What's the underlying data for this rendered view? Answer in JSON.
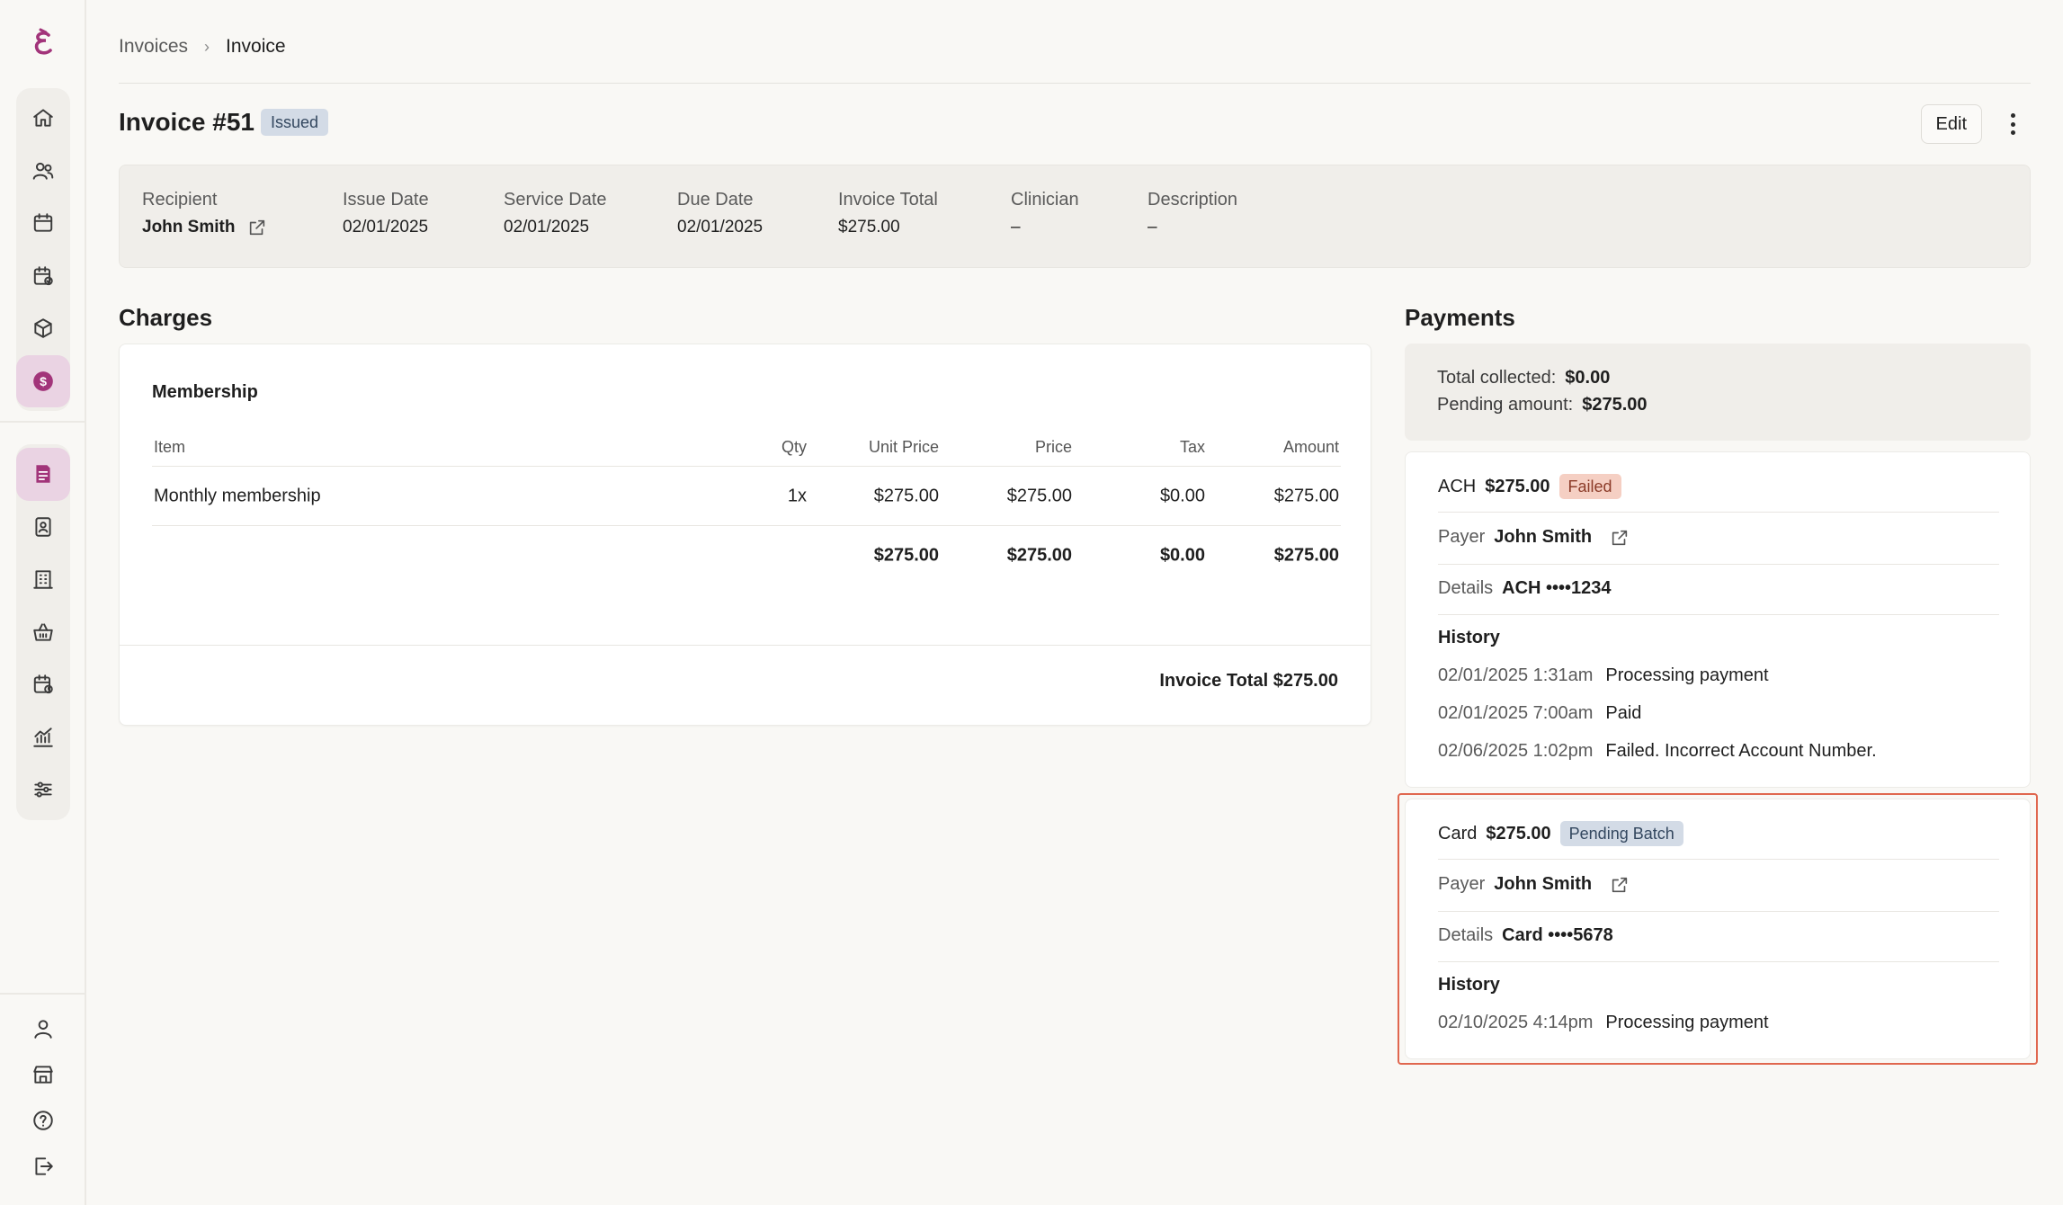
{
  "sidebar": {
    "logo": "brand-logo",
    "group1": [
      "home-icon",
      "users-icon",
      "calendar-icon",
      "calendar-check-icon",
      "box-icon",
      "dollar-icon"
    ],
    "group2": [
      "invoice-icon",
      "badge-icon",
      "building-icon",
      "basket-icon",
      "calendar-clock-icon",
      "chart-icon",
      "sliders-icon"
    ],
    "bottom": [
      "user-icon",
      "store-icon",
      "help-icon",
      "logout-icon"
    ],
    "active_item": "dollar-icon",
    "accent": "#a2347a"
  },
  "breadcrumb": {
    "items": [
      "Invoices",
      "Invoice"
    ]
  },
  "header": {
    "title": "Invoice #51",
    "status": "Issued",
    "edit_label": "Edit"
  },
  "summary": {
    "recipient_label": "Recipient",
    "recipient_value": "John Smith",
    "issue_date_label": "Issue Date",
    "issue_date_value": "02/01/2025",
    "service_date_label": "Service Date",
    "service_date_value": "02/01/2025",
    "due_date_label": "Due Date",
    "due_date_value": "02/01/2025",
    "invoice_total_label": "Invoice Total",
    "invoice_total_value": "$275.00",
    "clinician_label": "Clinician",
    "clinician_value": "–",
    "description_label": "Description",
    "description_value": "–"
  },
  "charges": {
    "title": "Charges",
    "group": "Membership",
    "columns": [
      "Item",
      "Qty",
      "Unit Price",
      "Price",
      "Tax",
      "Amount"
    ],
    "rows": [
      {
        "item": "Monthly membership",
        "qty": "1x",
        "unit": "$275.00",
        "price": "$275.00",
        "tax": "$0.00",
        "amount": "$275.00"
      }
    ],
    "totals": {
      "unit": "$275.00",
      "price": "$275.00",
      "tax": "$0.00",
      "amount": "$275.00"
    },
    "invoice_total": "Invoice Total $275.00"
  },
  "payments": {
    "title": "Payments",
    "total_collected_label": "Total collected:",
    "total_collected_value": "$0.00",
    "pending_amount_label": "Pending amount:",
    "pending_amount_value": "$275.00",
    "ach": {
      "method": "ACH",
      "amount": "$275.00",
      "status": "Failed",
      "payer_label": "Payer",
      "payer_value": "John Smith",
      "details_label": "Details",
      "details_value": "ACH ••••1234",
      "history_label": "History",
      "history": [
        {
          "time": "02/01/2025 1:31am",
          "event": "Processing payment"
        },
        {
          "time": "02/01/2025 7:00am",
          "event": "Paid"
        },
        {
          "time": "02/06/2025 1:02pm",
          "event": "Failed. Incorrect Account Number."
        }
      ]
    },
    "card": {
      "method": "Card",
      "amount": "$275.00",
      "status": "Pending Batch",
      "payer_label": "Payer",
      "payer_value": "John Smith",
      "details_label": "Details",
      "details_value": "Card ••••5678",
      "history_label": "History",
      "history": [
        {
          "time": "02/10/2025 4:14pm",
          "event": "Processing payment"
        }
      ]
    }
  },
  "colors": {
    "failed_bg": "#f5cfc3",
    "pending_bg": "#d3dbe6",
    "highlight_border": "#e0674f"
  }
}
